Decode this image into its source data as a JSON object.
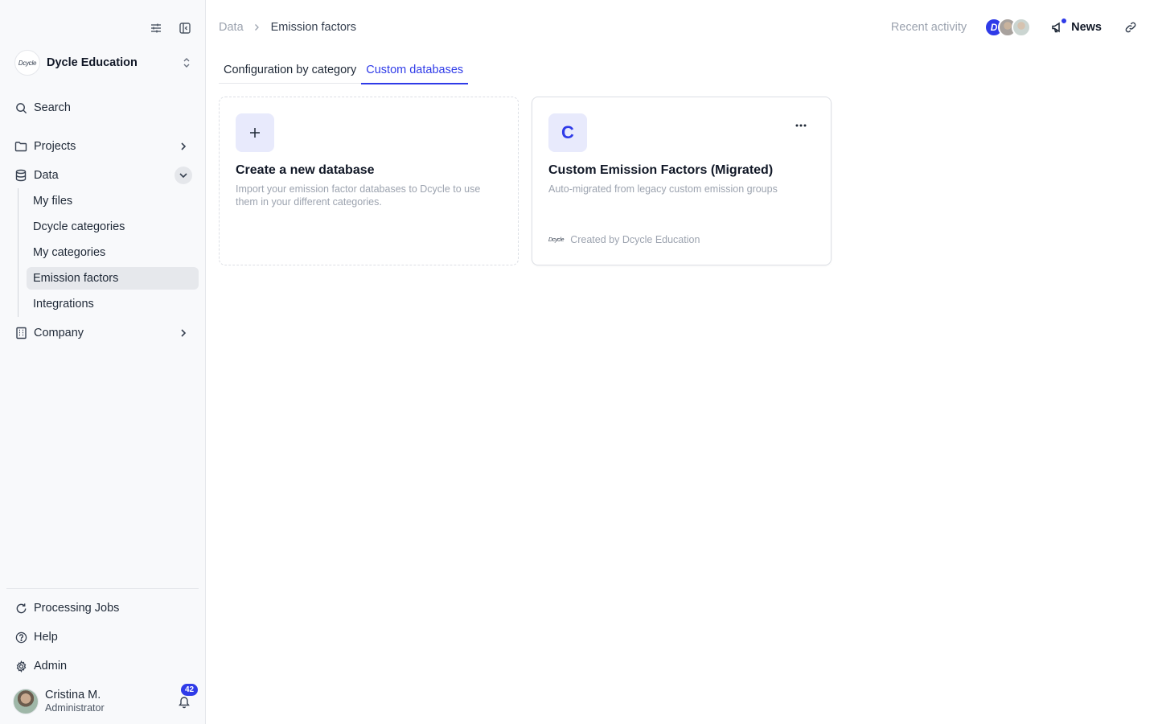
{
  "sidebar": {
    "org": {
      "logo_text": "Dcycle",
      "name": "Dycle Education"
    },
    "search_label": "Search",
    "projects_label": "Projects",
    "data_label": "Data",
    "data_children": [
      "My files",
      "Dcycle categories",
      "My categories",
      "Emission factors",
      "Integrations"
    ],
    "company_label": "Company",
    "processing_label": "Processing Jobs",
    "help_label": "Help",
    "admin_label": "Admin",
    "user": {
      "name": "Cristina M.",
      "role": "Administrator",
      "notifications": "42"
    }
  },
  "header": {
    "breadcrumb_root": "Data",
    "breadcrumb_current": "Emission factors",
    "recent_activity": "Recent activity",
    "avatar_initial": "D",
    "news_label": "News"
  },
  "tabs": [
    "Configuration by category",
    "Custom databases"
  ],
  "cards": {
    "new_db": {
      "title": "Create a new database",
      "description": "Import your emission factor databases to Dcycle to use them in your different categories."
    },
    "custom_db": {
      "initial": "C",
      "title": "Custom Emission Factors (Migrated)",
      "description": "Auto-migrated from legacy custom emission groups",
      "creator_logo": "Dcycle",
      "creator": "Created by Dcycle Education"
    }
  },
  "colors": {
    "accent": "#2f3be8",
    "sidebar_bg": "#f8f9fb",
    "active_item_bg": "#e6e8ec"
  }
}
